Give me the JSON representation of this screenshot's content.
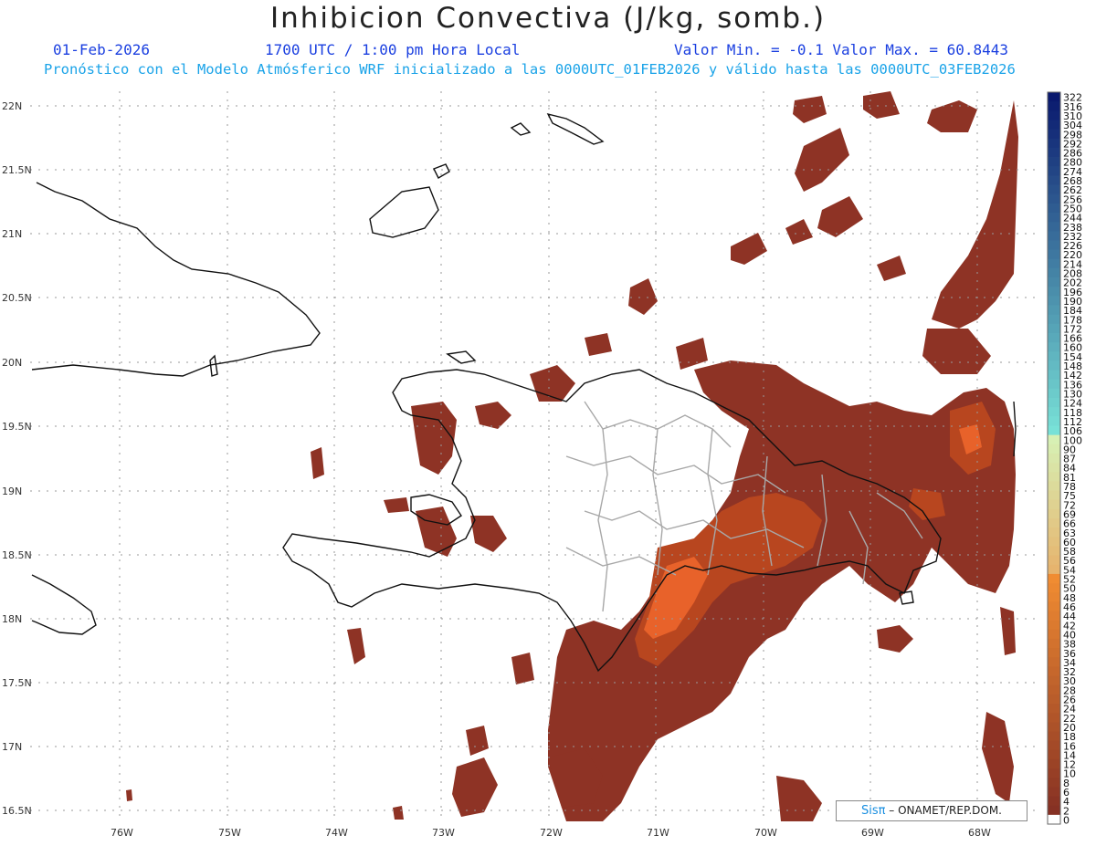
{
  "header": {
    "title": "Inhibicion Convectiva (J/kg, somb.)",
    "date": "01-Feb-2026",
    "time": "1700 UTC / 1:00 pm Hora Local",
    "min_max": "Valor Min. = -0.1  Valor Max. = 60.8443",
    "subtitle": "Pronóstico con el Modelo Atmósferico WRF inicializado a las 0000UTC_01FEB2026 y válido hasta las  0000UTC_03FEB2026"
  },
  "map": {
    "lat_labels": [
      "22N",
      "21.5N",
      "21N",
      "20.5N",
      "20N",
      "19.5N",
      "19N",
      "18.5N",
      "18N",
      "17.5N",
      "17N",
      "16.5N"
    ],
    "lon_labels": [
      "76W",
      "75W",
      "74W",
      "73W",
      "72W",
      "71W",
      "70W",
      "69W",
      "68W"
    ],
    "colors": {
      "cin_dark": "#8e3325",
      "cin_mid": "#b8461f",
      "cin_bright": "#e8622a",
      "coast": "#111111",
      "border": "#a8a8a8"
    }
  },
  "colorbar": {
    "labels": [
      "322",
      "316",
      "310",
      "304",
      "298",
      "292",
      "286",
      "280",
      "274",
      "268",
      "262",
      "256",
      "250",
      "244",
      "238",
      "232",
      "226",
      "220",
      "214",
      "208",
      "202",
      "196",
      "190",
      "184",
      "178",
      "172",
      "166",
      "160",
      "154",
      "148",
      "142",
      "136",
      "130",
      "124",
      "118",
      "112",
      "106",
      "100",
      "90",
      "87",
      "84",
      "81",
      "78",
      "75",
      "72",
      "69",
      "66",
      "63",
      "60",
      "58",
      "56",
      "54",
      "52",
      "50",
      "48",
      "46",
      "44",
      "42",
      "40",
      "38",
      "36",
      "34",
      "32",
      "30",
      "28",
      "26",
      "24",
      "22",
      "20",
      "18",
      "16",
      "14",
      "12",
      "10",
      "8",
      "6",
      "4",
      "2",
      "0"
    ]
  },
  "credit": {
    "sis": "Sisπ",
    "text": "– ONAMET/REP.DOM."
  }
}
